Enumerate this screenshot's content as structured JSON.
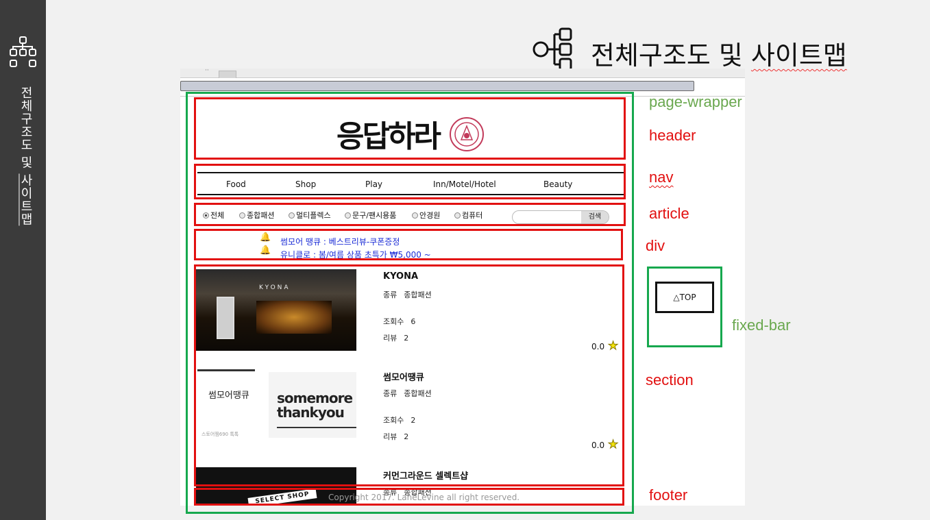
{
  "slide": {
    "side_title_plain": "전체구조도 및 ",
    "side_title_underlined": "사이트맵",
    "heading_plain": "전체구조도 및 ",
    "heading_underlined": "사이트맵"
  },
  "site": {
    "logo": "응답하라",
    "nav": [
      "Food",
      "Shop",
      "Play",
      "Inn/Motel/Hotel",
      "Beauty"
    ],
    "filters": [
      {
        "label": "전체",
        "selected": true
      },
      {
        "label": "종합패션",
        "selected": false
      },
      {
        "label": "멀티플렉스",
        "selected": false
      },
      {
        "label": "문구/팬시용품",
        "selected": false
      },
      {
        "label": "안경원",
        "selected": false
      },
      {
        "label": "컴퓨터",
        "selected": false
      }
    ],
    "search_button": "검색",
    "notices": [
      "썸모어 땡큐 : 베스트리뷰-쿠폰증정",
      "유니클로 : 봄/여름 상품 초특가 ₩5,000 ~"
    ],
    "items": [
      {
        "title": "KYONA",
        "type_label": "종류",
        "type": "종합패션",
        "views_label": "조회수",
        "views": "6",
        "reviews_label": "리뷰",
        "reviews": "2",
        "rating": "0.0"
      },
      {
        "title": "썸모어땡큐",
        "type_label": "종류",
        "type": "종합패션",
        "views_label": "조회수",
        "views": "2",
        "reviews_label": "리뷰",
        "reviews": "2",
        "rating": "0.0"
      },
      {
        "title": "커먼그라운드 셀렉트샵",
        "type_label": "종류",
        "type": "종합패션"
      }
    ],
    "thumb1_sign": "KYONA",
    "thumb2_name": "썸모어땡큐",
    "thumb2_card": [
      "somemore",
      "thankyou"
    ],
    "thumb2_mini": "스토어찜690  톡톡",
    "thumb3_banner": "SELECT SHOP",
    "copyright": "Copyright 2017. LaneLevine all right reserved.",
    "top_button": "△TOP"
  },
  "labels": {
    "page_wrapper": "page-wrapper",
    "header": "header",
    "nav": "nav",
    "article": "article",
    "div": "div",
    "section": "section",
    "fixed_bar": "fixed-bar",
    "footer": "footer"
  },
  "colors": {
    "green": "#16a84e",
    "red": "#e21010",
    "label_green": "#6aa84f",
    "notice_blue": "#1a2bd6"
  }
}
